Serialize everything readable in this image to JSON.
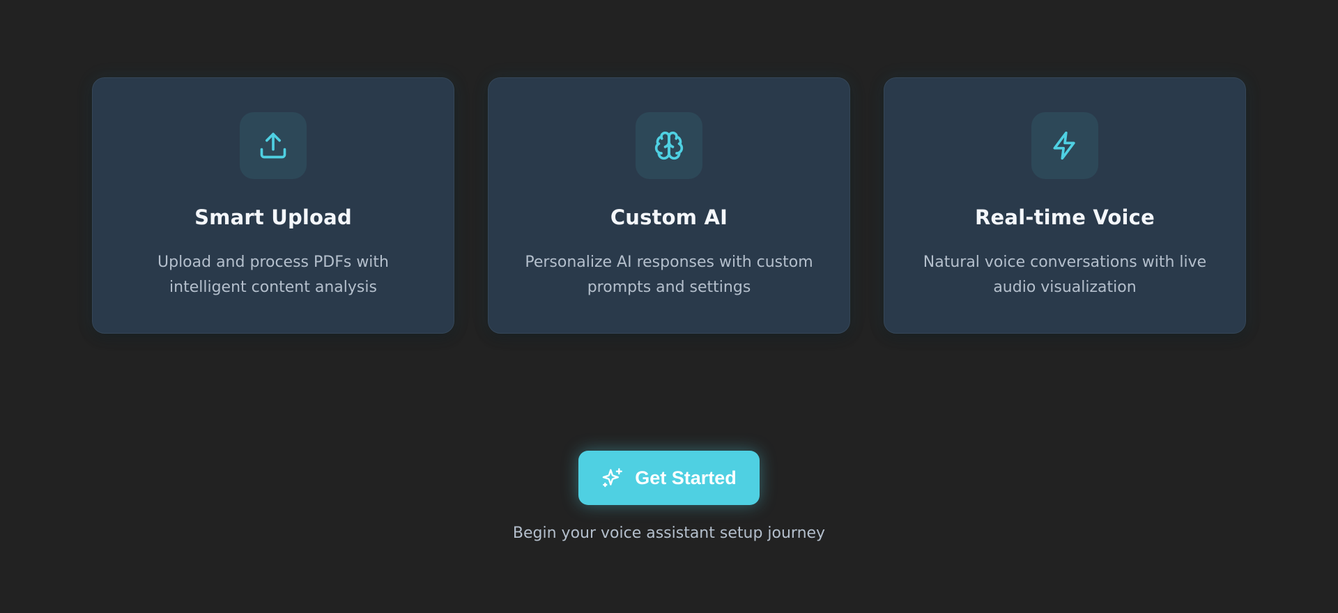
{
  "features": [
    {
      "icon": "upload-icon",
      "title": "Smart Upload",
      "description": "Upload and process PDFs with intelligent content analysis"
    },
    {
      "icon": "brain-icon",
      "title": "Custom AI",
      "description": "Personalize AI responses with custom prompts and settings"
    },
    {
      "icon": "lightning-icon",
      "title": "Real-time Voice",
      "description": "Natural voice conversations with live audio visualization"
    }
  ],
  "cta": {
    "icon": "sparkles-icon",
    "label": "Get Started",
    "subtext": "Begin your voice assistant setup journey"
  },
  "colors": {
    "background": "#222222",
    "card": "#2a3a4b",
    "accent": "#4fd0e2"
  }
}
